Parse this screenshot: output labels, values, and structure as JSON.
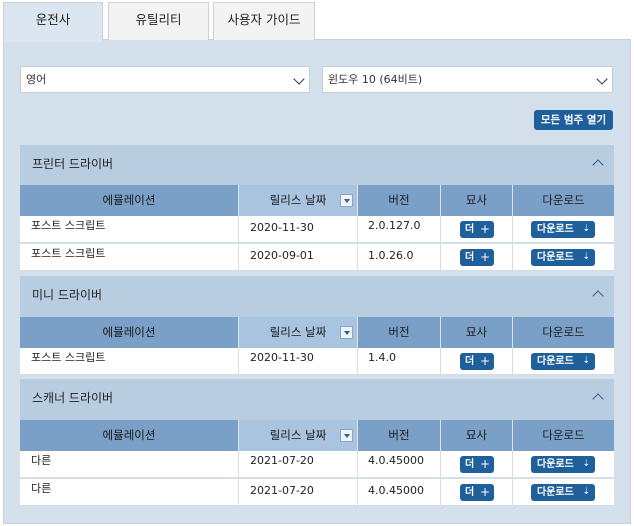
{
  "tabs": [
    "운전사",
    "유틸리티",
    "사용자 가이드"
  ],
  "filters": {
    "language": "영어",
    "os": "윈도우 10 (64비트)"
  },
  "expand_all_label": "모든 범주 열기",
  "columns": [
    "에뮬레이션",
    "릴리스 날짜",
    "버전",
    "묘사",
    "다운로드"
  ],
  "more_label": "더",
  "download_label": "다운로드",
  "sections": [
    {
      "title": "프린터 드라이버",
      "rows": [
        {
          "emulation": "포스트 스크립트",
          "date": "2020-11-30",
          "version": "2.0.127.0"
        },
        {
          "emulation": "포스트 스크립트",
          "date": "2020-09-01",
          "version": "1.0.26.0"
        }
      ]
    },
    {
      "title": "미니 드라이버",
      "rows": [
        {
          "emulation": "포스트 스크립트",
          "date": "2020-11-30",
          "version": "1.4.0"
        }
      ]
    },
    {
      "title": "스캐너 드라이버",
      "rows": [
        {
          "emulation": "다른",
          "date": "2021-07-20",
          "version": "4.0.45000"
        },
        {
          "emulation": "다른",
          "date": "2021-07-20",
          "version": "4.0.45000"
        }
      ]
    }
  ],
  "colors": {
    "button": "#1f5f9c",
    "table_header": "#7aa0c8",
    "section_header": "#b9cde0",
    "panel": "#d4e0eb"
  }
}
